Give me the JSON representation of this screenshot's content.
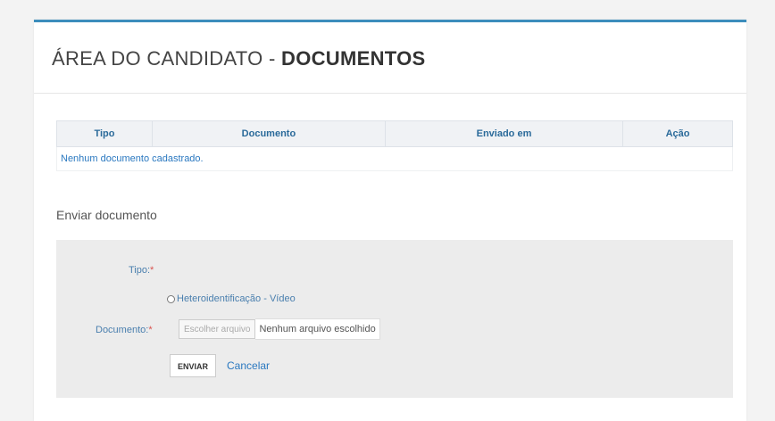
{
  "page": {
    "title_prefix": "ÁREA DO CANDIDATO - ",
    "title_bold": "DOCUMENTOS"
  },
  "documents_table": {
    "headers": [
      "Tipo",
      "Documento",
      "Enviado em",
      "Ação"
    ],
    "empty_message": "Nenhum documento cadastrado."
  },
  "upload_form": {
    "section_title": "Enviar documento",
    "tipo_label": "Tipo:",
    "required_marker": "*",
    "tipo_options": [
      "Heteroidentificação - Vídeo"
    ],
    "documento_label": "Documento:",
    "file_button_label": "Escolher arquivo",
    "file_status": "Nenhum arquivo escolhido",
    "submit_label": "ENVIAR",
    "cancel_label": "Cancelar"
  },
  "colors": {
    "accent_border": "#3c8dbc",
    "link": "#2a78c0",
    "required": "#d9534f"
  }
}
